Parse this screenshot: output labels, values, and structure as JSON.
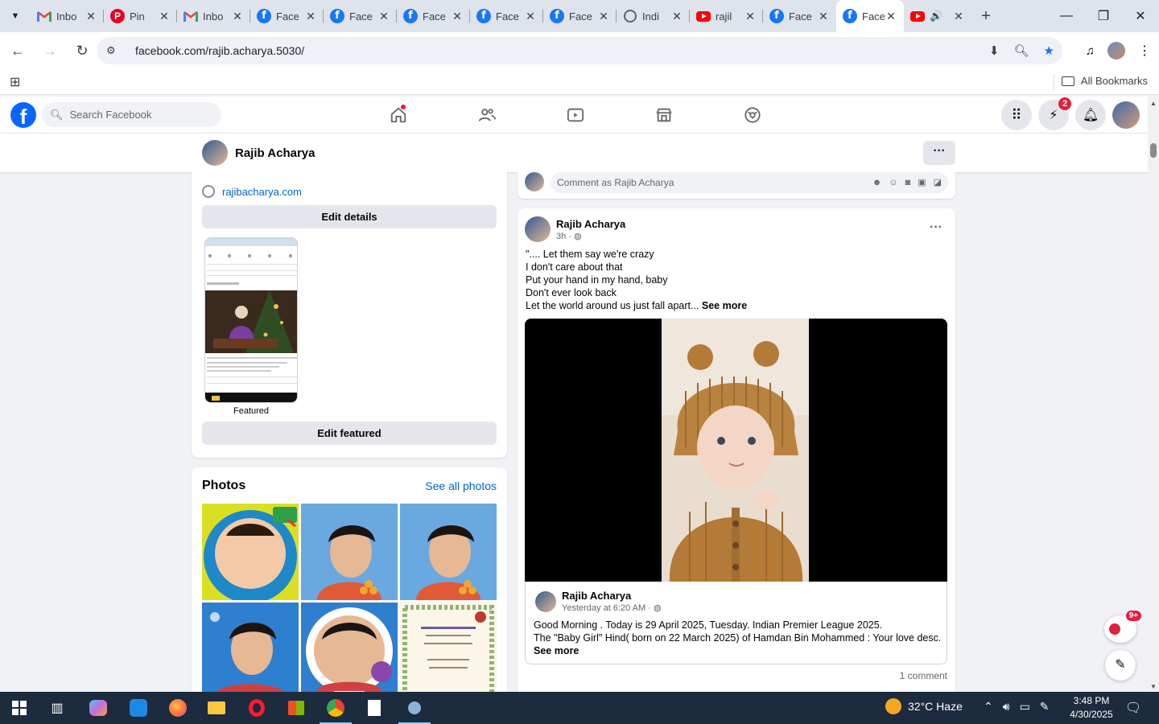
{
  "browser": {
    "tabs": [
      {
        "title": "Inbo",
        "icon": "gmail-icon"
      },
      {
        "title": "Pin",
        "icon": "pinterest-icon"
      },
      {
        "title": "Inbo",
        "icon": "gmail-icon"
      },
      {
        "title": "Face",
        "icon": "facebook-icon"
      },
      {
        "title": "Face",
        "icon": "facebook-icon"
      },
      {
        "title": "Face",
        "icon": "facebook-icon"
      },
      {
        "title": "Face",
        "icon": "facebook-icon"
      },
      {
        "title": "Face",
        "icon": "facebook-icon"
      },
      {
        "title": "Indi",
        "icon": "globe-icon"
      },
      {
        "title": "rajil",
        "icon": "youtube-icon"
      },
      {
        "title": "Face",
        "icon": "facebook-icon"
      },
      {
        "title": "Face",
        "icon": "facebook-icon",
        "active": true
      },
      {
        "title": "",
        "icon": "youtube-icon"
      }
    ],
    "url": "facebook.com/rajib.acharya.5030/",
    "all_bookmarks": "All Bookmarks"
  },
  "fb": {
    "search_placeholder": "Search Facebook",
    "messenger_badge": "2",
    "colors": {
      "brand": "#0866ff",
      "link": "#0064d1",
      "badge": "#e41e3f"
    }
  },
  "profile": {
    "name": "Rajib Acharya",
    "website": "rajibacharya.com",
    "edit_details": "Edit details",
    "featured_label": "Featured",
    "edit_featured": "Edit featured"
  },
  "photos": {
    "title": "Photos",
    "see_all": "See all photos"
  },
  "comment_bar": {
    "placeholder": "Comment as Rajib Acharya"
  },
  "post": {
    "author": "Rajib Acharya",
    "time": "3h · ",
    "lines": [
      "\".... Let them say we're crazy",
      "I don't care about that",
      "Put your hand in my hand, baby",
      "Don't ever look back",
      "Let the world around us just fall apart..."
    ],
    "see_more": "See more",
    "shared": {
      "author": "Rajib Acharya",
      "time": "Yesterday at 6:20 AM · ",
      "line1": "Good Morning . Today is 29 April 2025, Tuesday. Indian Premier League 2025.",
      "line2": "The \"Baby Girl\" Hind( born on 22 March 2025) of Hamdan Bin Mohammed : Your love desc...",
      "see_more": "See more"
    },
    "comments": "1 comment"
  },
  "floating": {
    "news_count": "9+"
  },
  "taskbar": {
    "weather": "32°C  Haze",
    "time": "3:48 PM",
    "date": "4/30/2025"
  }
}
